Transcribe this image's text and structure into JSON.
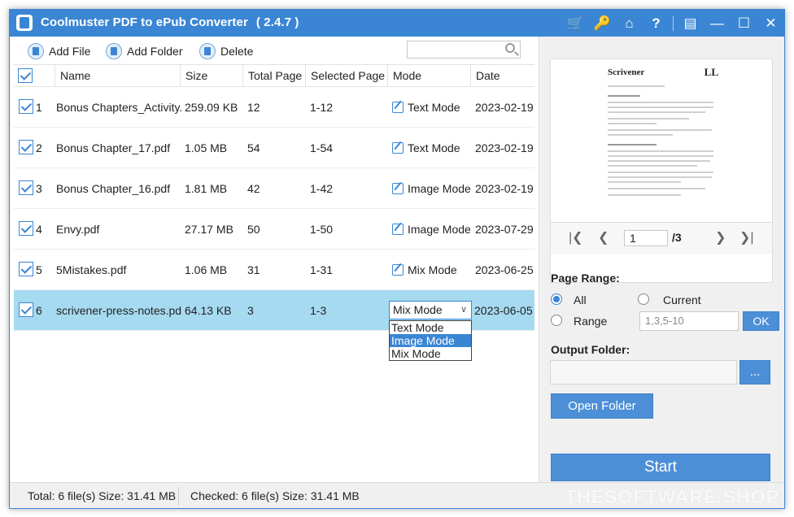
{
  "window": {
    "title": "Coolmuster PDF to ePub Converter",
    "version": "( 2.4.7 )",
    "accent_color": "#3a86d4",
    "title_icons": [
      "cart-icon",
      "key-icon",
      "home-icon",
      "help-icon",
      "feedback-icon",
      "minimize-icon",
      "maximize-icon",
      "close-icon"
    ]
  },
  "toolbar": {
    "add_file": "Add File",
    "add_folder": "Add Folder",
    "delete": "Delete",
    "search_placeholder": ""
  },
  "table": {
    "headers": [
      "Name",
      "Size",
      "Total Page",
      "Selected Page",
      "Mode",
      "Date"
    ],
    "rows": [
      {
        "index": "1",
        "name": "Bonus Chapters_Activity...",
        "size": "259.09 KB",
        "total": "12",
        "selected": "1-12",
        "mode": "Text Mode",
        "date": "2023-02-19",
        "checked": true
      },
      {
        "index": "2",
        "name": "Bonus Chapter_17.pdf",
        "size": "1.05 MB",
        "total": "54",
        "selected": "1-54",
        "mode": "Text Mode",
        "date": "2023-02-19",
        "checked": true
      },
      {
        "index": "3",
        "name": "Bonus Chapter_16.pdf",
        "size": "1.81 MB",
        "total": "42",
        "selected": "1-42",
        "mode": "Image Mode",
        "date": "2023-02-19",
        "checked": true
      },
      {
        "index": "4",
        "name": "Envy.pdf",
        "size": "27.17 MB",
        "total": "50",
        "selected": "1-50",
        "mode": "Image Mode",
        "date": "2023-07-29",
        "checked": true
      },
      {
        "index": "5",
        "name": "5Mistakes.pdf",
        "size": "1.06 MB",
        "total": "31",
        "selected": "1-31",
        "mode": "Mix Mode",
        "date": "2023-06-25",
        "checked": true
      },
      {
        "index": "6",
        "name": "scrivener-press-notes.pdf",
        "size": "64.13 KB",
        "total": "3",
        "selected": "1-3",
        "mode": "Mix Mode",
        "date": "2023-06-05",
        "checked": true
      }
    ],
    "mode_options": [
      "Text Mode",
      "Image Mode",
      "Mix Mode"
    ],
    "highlighted_option": "Image Mode"
  },
  "preview": {
    "page_logo": "Scrivener",
    "page_logo2": "LL",
    "current_page": "1",
    "total_pages": "/3"
  },
  "page_range": {
    "label": "Page Range:",
    "all": "All",
    "current": "Current",
    "range": "Range",
    "range_value": "1,3,5-10",
    "ok": "OK"
  },
  "output": {
    "label": "Output Folder:",
    "browse": "...",
    "open_folder": "Open Folder"
  },
  "start": "Start",
  "status": {
    "total": "Total: 6 file(s) Size: 31.41 MB",
    "checked": "Checked: 6 file(s) Size: 31.41 MB",
    "watermark": "© THESOFTWARE.SHOP"
  }
}
